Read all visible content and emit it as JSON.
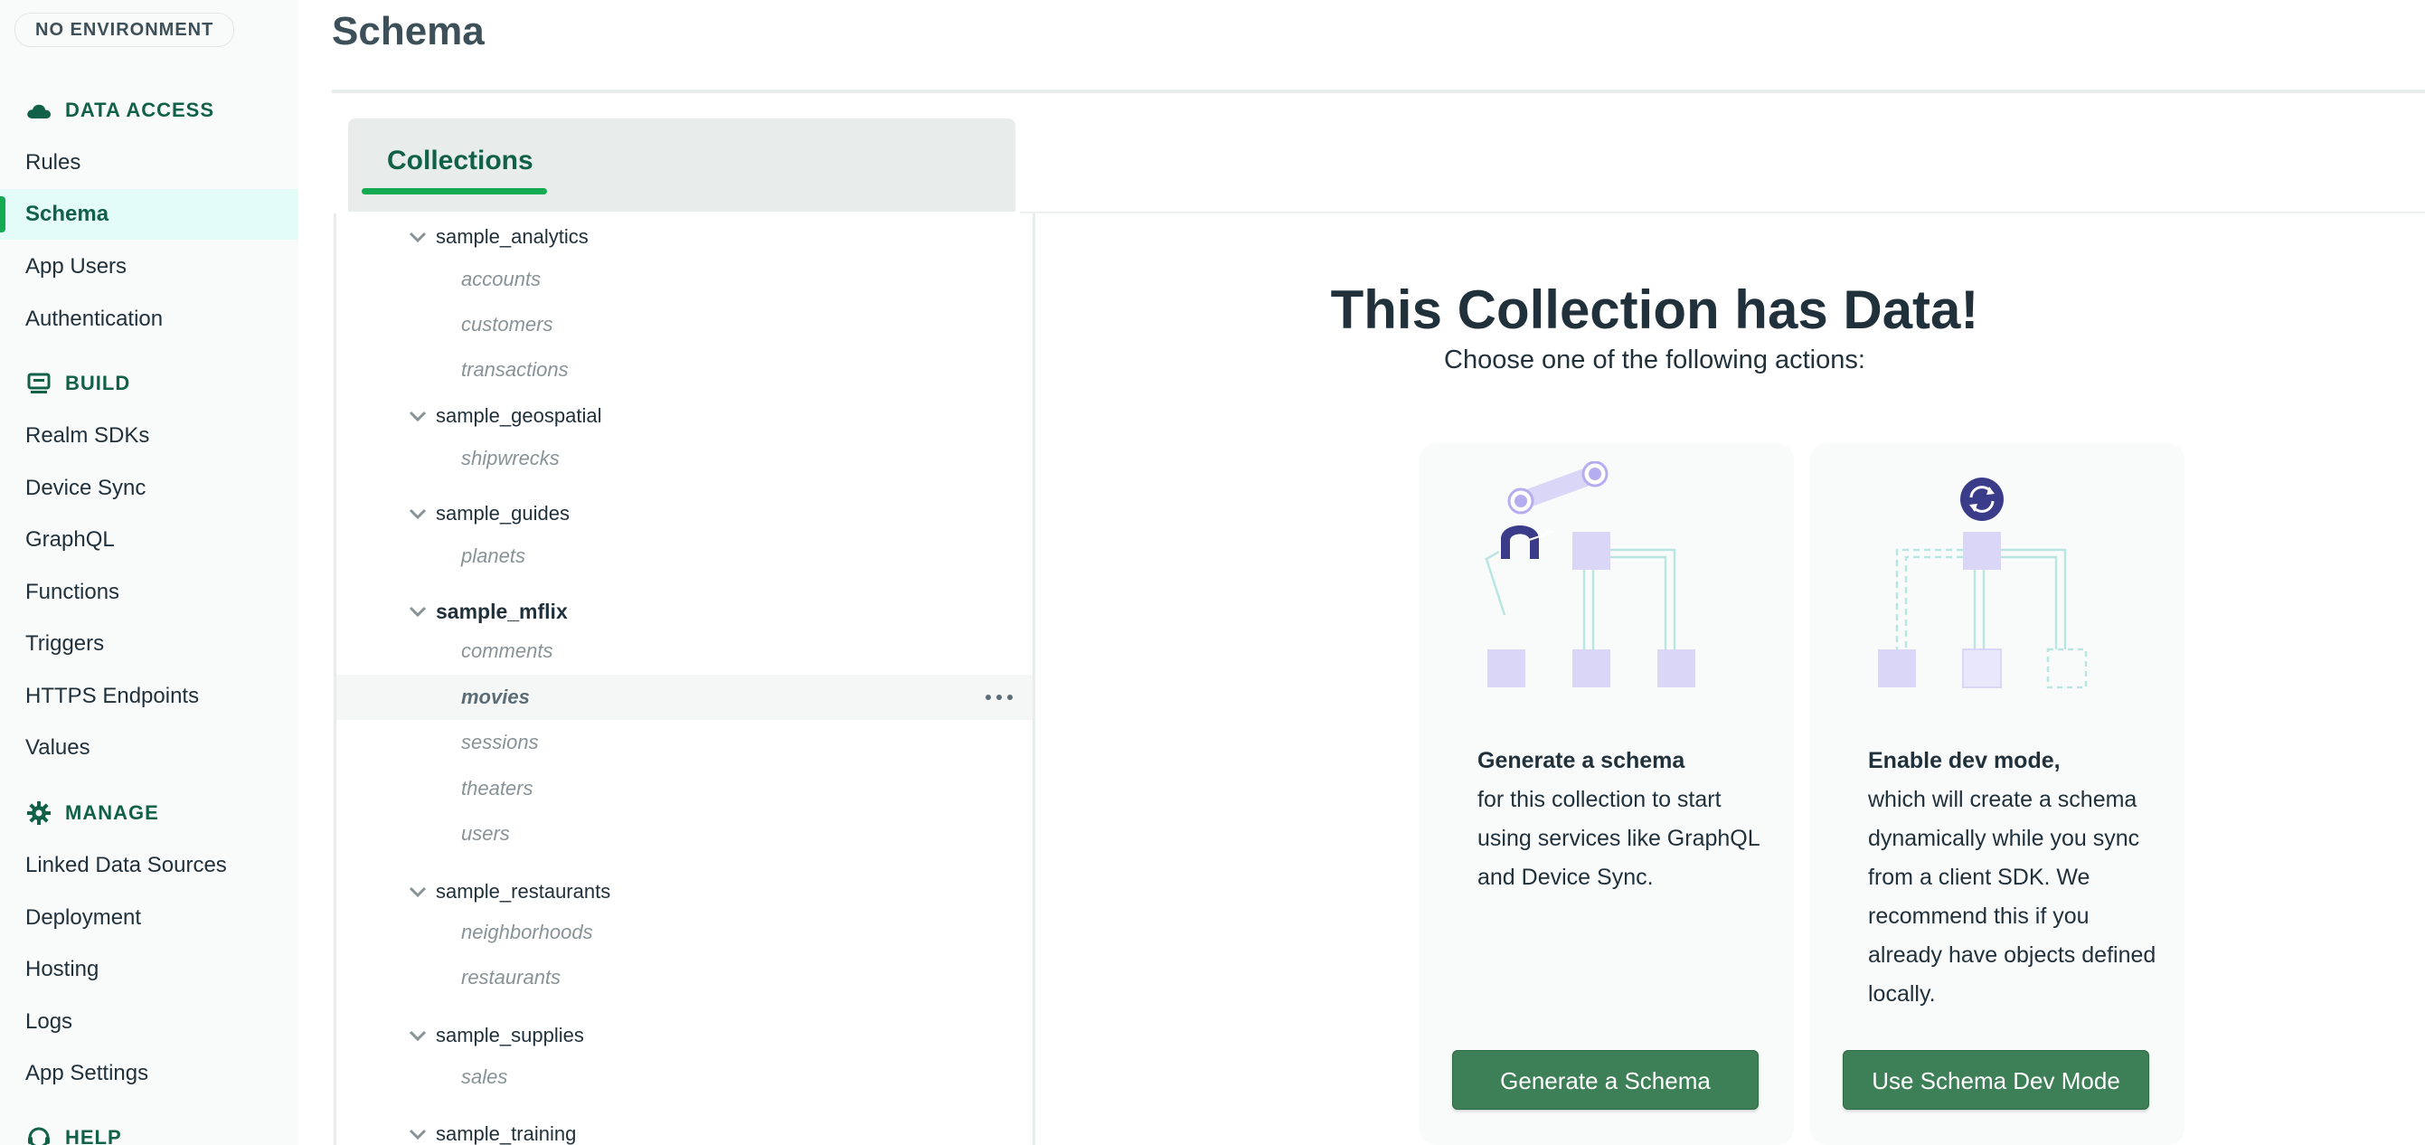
{
  "environment_badge": "NO ENVIRONMENT",
  "page_title": "Schema",
  "sidebar": {
    "sections": [
      {
        "label": "DATA ACCESS",
        "icon": "cloud-icon"
      },
      {
        "label": "BUILD",
        "icon": "build-icon"
      },
      {
        "label": "MANAGE",
        "icon": "gear-icon"
      },
      {
        "label": "HELP",
        "icon": "help-icon"
      }
    ],
    "items": [
      {
        "label": "Rules"
      },
      {
        "label": "Schema",
        "active": true
      },
      {
        "label": "App Users"
      },
      {
        "label": "Authentication"
      },
      {
        "label": "Realm SDKs"
      },
      {
        "label": "Device Sync"
      },
      {
        "label": "GraphQL"
      },
      {
        "label": "Functions"
      },
      {
        "label": "Triggers"
      },
      {
        "label": "HTTPS Endpoints"
      },
      {
        "label": "Values"
      },
      {
        "label": "Linked Data Sources"
      },
      {
        "label": "Deployment"
      },
      {
        "label": "Hosting"
      },
      {
        "label": "Logs"
      },
      {
        "label": "App Settings"
      }
    ]
  },
  "tabs": [
    {
      "label": "Collections",
      "active": true
    }
  ],
  "tree": {
    "databases": [
      {
        "name": "sample_analytics",
        "collections": [
          "accounts",
          "customers",
          "transactions"
        ]
      },
      {
        "name": "sample_geospatial",
        "collections": [
          "shipwrecks"
        ]
      },
      {
        "name": "sample_guides",
        "collections": [
          "planets"
        ]
      },
      {
        "name": "sample_mflix",
        "bold": true,
        "collections": [
          "comments",
          "movies",
          "sessions",
          "theaters",
          "users"
        ]
      },
      {
        "name": "sample_restaurants",
        "collections": [
          "neighborhoods",
          "restaurants"
        ]
      },
      {
        "name": "sample_supplies",
        "collections": [
          "sales"
        ]
      },
      {
        "name": "sample_training",
        "collections": []
      }
    ],
    "selected_collection": "movies"
  },
  "empty_state": {
    "title": "This Collection has Data!",
    "subtitle": "Choose one of the following actions:",
    "cards": [
      {
        "heading": "Generate a schema",
        "body": "for this collection to start using services like GraphQL and Device Sync.",
        "button": "Generate a Schema"
      },
      {
        "heading": "Enable dev mode,",
        "body": "which will create a schema dynamically while you sync from a client SDK. We recommend this if you already have objects defined locally.",
        "button": "Use Schema Dev Mode"
      }
    ]
  },
  "colors": {
    "accent": "#13aa52",
    "brand_dark": "#116149",
    "button": "#3d7f56",
    "illustration_purple": "#d9d6f7",
    "illustration_navy": "#3a3c8a"
  }
}
